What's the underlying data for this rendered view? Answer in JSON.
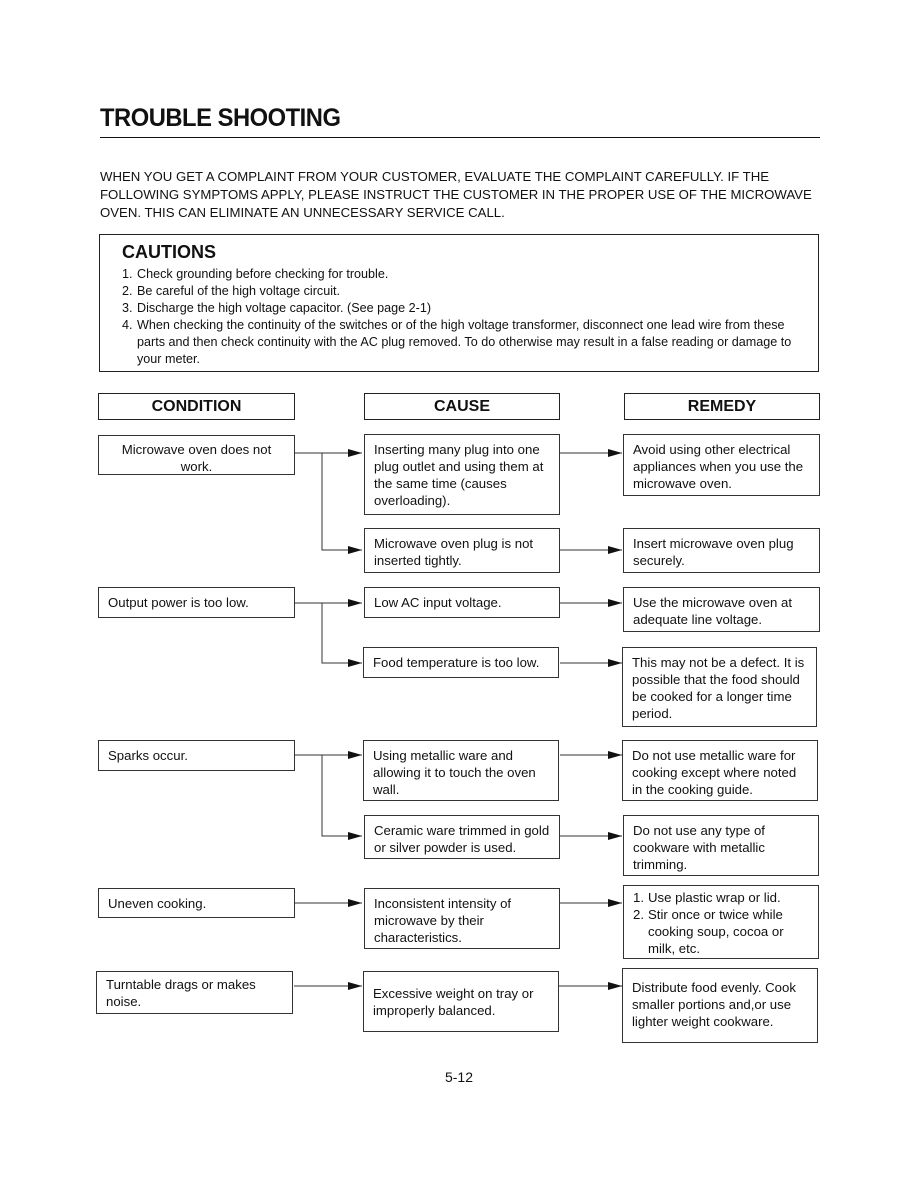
{
  "header": {
    "title": "TROUBLE SHOOTING"
  },
  "intro": "WHEN YOU GET A COMPLAINT FROM YOUR CUSTOMER, EVALUATE THE COMPLAINT CAREFULLY. IF THE FOLLOWING SYMPTOMS APPLY, PLEASE INSTRUCT THE CUSTOMER IN THE PROPER USE OF THE MICROWAVE OVEN. THIS CAN ELIMINATE AN UNNECESSARY SERVICE CALL.",
  "cautions": {
    "title": "CAUTIONS",
    "items": [
      {
        "num": "1.",
        "text": "Check grounding before checking for trouble."
      },
      {
        "num": "2.",
        "text": "Be careful of the high voltage circuit."
      },
      {
        "num": "3.",
        "text": "Discharge the high voltage capacitor. (See page 2-1)"
      },
      {
        "num": "4.",
        "text": "When checking the continuity of the switches or of the high voltage transformer, disconnect one lead wire from these parts and then check continuity with the AC plug removed. To do otherwise may result in a false reading or damage to your meter."
      }
    ]
  },
  "columns": {
    "condition": "CONDITION",
    "cause": "CAUSE",
    "remedy": "REMEDY"
  },
  "conditions": [
    "Microwave oven does not work.",
    "Output power is too low.",
    "Sparks occur.",
    "Uneven cooking.",
    "Turntable drags or makes noise."
  ],
  "causes": [
    "Inserting many plug into one plug outlet and using them at the same time (causes overloading).",
    "Microwave oven plug is not inserted tightly.",
    "Low AC input voltage.",
    "Food temperature is too low.",
    "Using metallic ware and allowing it to touch the oven wall.",
    "Ceramic ware trimmed in gold or silver powder is used.",
    "Inconsistent intensity of microwave by their characteristics.",
    "Excessive weight on tray or improperly balanced."
  ],
  "remedies": [
    "Avoid using other electrical appliances when you use the microwave oven.",
    "Insert microwave oven plug securely.",
    "Use the microwave oven at adequate line voltage.",
    "This may not be a defect. It is possible that the food should be cooked for a longer time period.",
    "Do not use metallic ware for cooking except where noted in the cooking guide.",
    "Do not use any type of cookware with metallic trimming.",
    {
      "items": [
        {
          "num": "1.",
          "text": "Use plastic wrap or lid."
        },
        {
          "num": "2.",
          "text": "Stir once or twice while cooking soup, cocoa or milk, etc."
        }
      ]
    },
    "Distribute food evenly. Cook smaller portions and,or use lighter weight cookware."
  ],
  "page_number": "5-12"
}
